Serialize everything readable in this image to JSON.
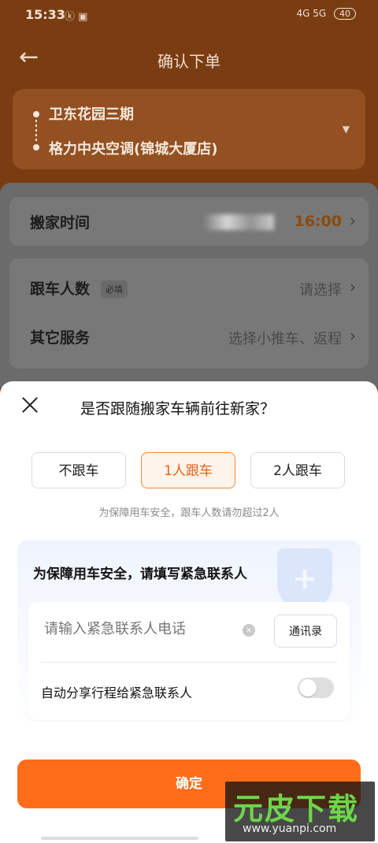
{
  "status": {
    "time": "15:33",
    "battery": "40",
    "network": "4G 5G",
    "icons_text": "ⓚ ▣"
  },
  "nav": {
    "title": "确认下单"
  },
  "route": {
    "from": "卫东花园三期",
    "to": "格力中央空调(锦城大厦店)"
  },
  "form": {
    "move_time_label": "搬家时间",
    "move_time_value": "16:00",
    "people_label": "跟车人数",
    "people_badge": "必填",
    "people_value": "请选择",
    "other_label": "其它服务",
    "other_value": "选择小推车、返程"
  },
  "sheet": {
    "title": "是否跟随搬家车辆前往新家？",
    "options": [
      "不跟车",
      "1人跟车",
      "2人跟车"
    ],
    "selected_index": 1,
    "note": "为保障用车安全，跟车人数请勿超过2人",
    "emergency_title": "为保障用车安全，请填写紧急联系人",
    "phone_placeholder": "请输入紧急联系人电话",
    "contacts_label": "通讯录",
    "share_label": "自动分享行程给紧急联系人",
    "share_enabled": false,
    "confirm_label": "确定"
  },
  "watermark": {
    "brand": "元皮下载",
    "url": "www.yuanpi.com"
  },
  "colors": {
    "accent": "#ff6c1a",
    "selected_bg": "#fff3ea"
  }
}
